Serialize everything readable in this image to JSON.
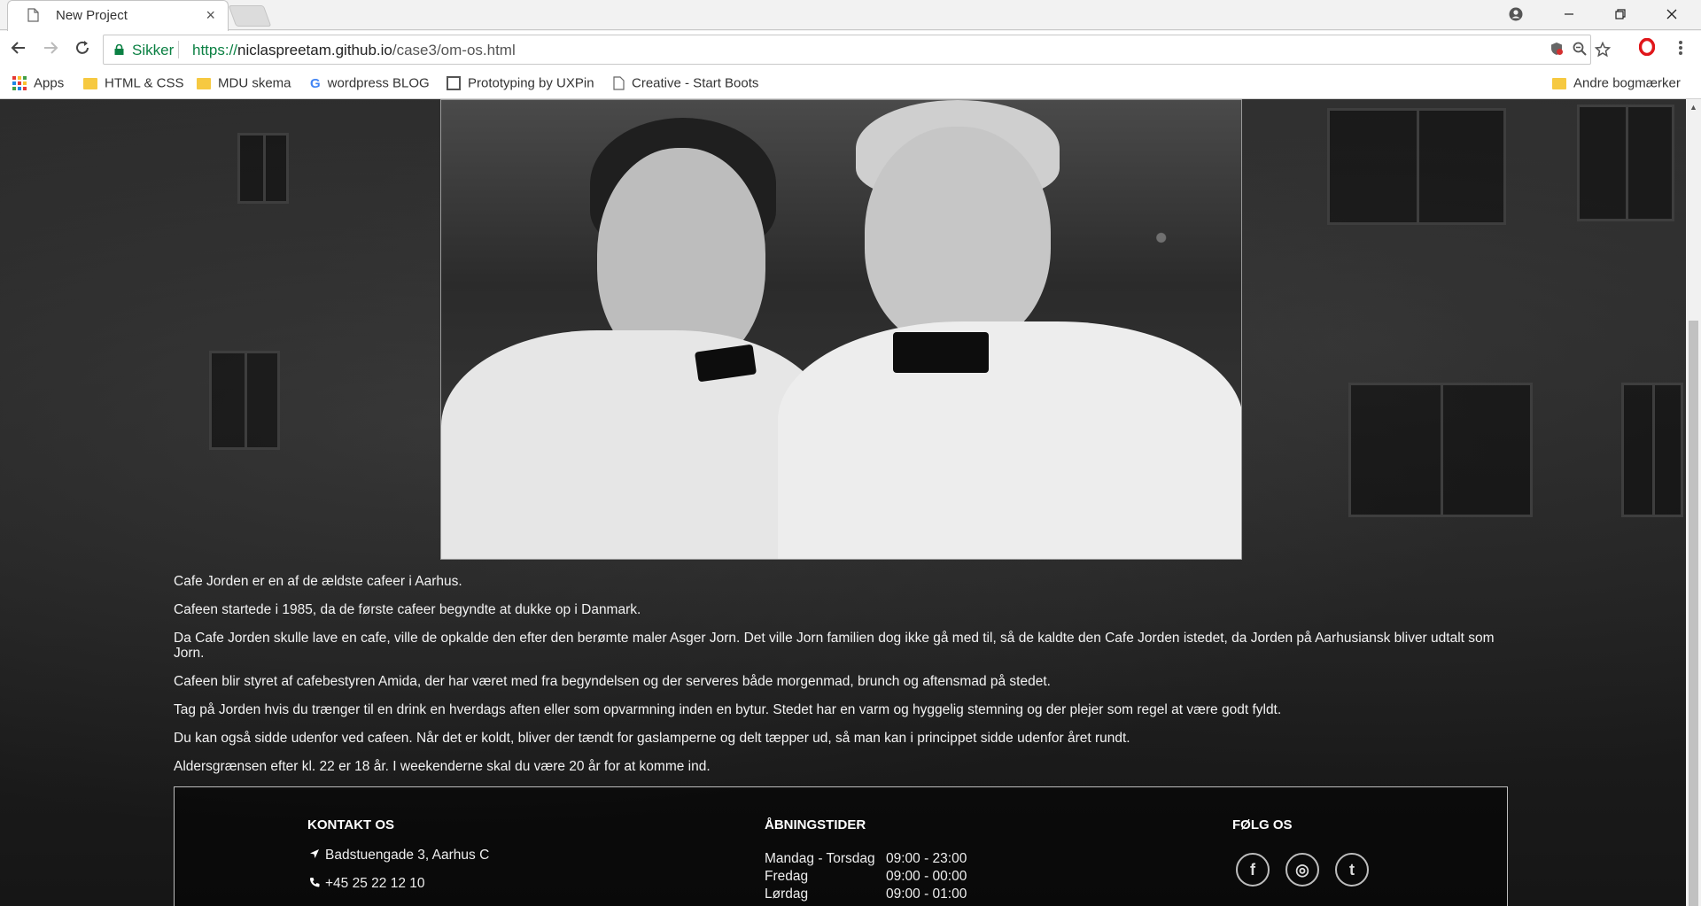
{
  "browser": {
    "tab_title": "New Project",
    "tab_close": "×",
    "secure_label": "Sikker",
    "url_scheme": "https://",
    "url_host": "niclaspreetam.github.io",
    "url_path": "/case3/om-os.html",
    "bookmarks": [
      {
        "label": "Apps",
        "icon": "apps-grid-icon"
      },
      {
        "label": "HTML & CSS",
        "icon": "folder-icon"
      },
      {
        "label": "MDU skema",
        "icon": "folder-icon"
      },
      {
        "label": "wordpress BLOG",
        "icon": "google-icon"
      },
      {
        "label": "Prototyping by UXPin",
        "icon": "square-icon"
      },
      {
        "label": "Creative - Start Boots",
        "icon": "document-icon"
      }
    ],
    "other_bookmarks": "Andre bogmærker"
  },
  "about": {
    "paragraphs": [
      "Cafe Jorden er en af de ældste cafeer i Aarhus.",
      "Cafeen startede i 1985, da de første cafeer begyndte at dukke op i Danmark.",
      "Da Cafe Jorden skulle lave en cafe, ville de opkalde den efter den berømte maler Asger Jorn. Det ville Jorn familien dog ikke gå med til, så de kaldte den Cafe Jorden istedet, da Jorden på Aarhusiansk bliver udtalt som Jorn.",
      "Cafeen blir styret af cafebestyren Amida, der har været med fra begyndelsen og der serveres både morgenmad, brunch og aftensmad på stedet.",
      "Tag på Jorden hvis du trænger til en drink en hverdags aften eller som opvarmning inden en bytur. Stedet har en varm og hyggelig stemning og der plejer som regel at være godt fyldt.",
      "Du kan også sidde udenfor ved cafeen. Når det er koldt, bliver der tændt for gaslamperne og delt tæpper ud, så man kan i princippet sidde udenfor året rundt.",
      "Aldersgrænsen efter kl. 22 er 18 år. I weekenderne skal du være 20 år for at komme ind."
    ]
  },
  "footer": {
    "contact_heading": "KONTAKT OS",
    "address": "Badstuengade 3, Aarhus C",
    "phone": "+45 25 22 12 10",
    "hours_heading": "ÅBNINGSTIDER",
    "hours": [
      {
        "day": "Mandag - Torsdag",
        "time": "09:00 - 23:00"
      },
      {
        "day": "Fredag",
        "time": "09:00 - 00:00"
      },
      {
        "day": "Lørdag",
        "time": "09:00 - 01:00"
      }
    ],
    "follow_heading": "FØLG OS",
    "social": [
      {
        "icon": "facebook-icon",
        "glyph": "f"
      },
      {
        "icon": "instagram-icon",
        "glyph": "◎"
      },
      {
        "icon": "tumblr-icon",
        "glyph": "t"
      }
    ]
  },
  "colors": {
    "secure_green": "#0b8043",
    "folder_yellow": "#f6c941",
    "opera_red": "#e0161a"
  }
}
